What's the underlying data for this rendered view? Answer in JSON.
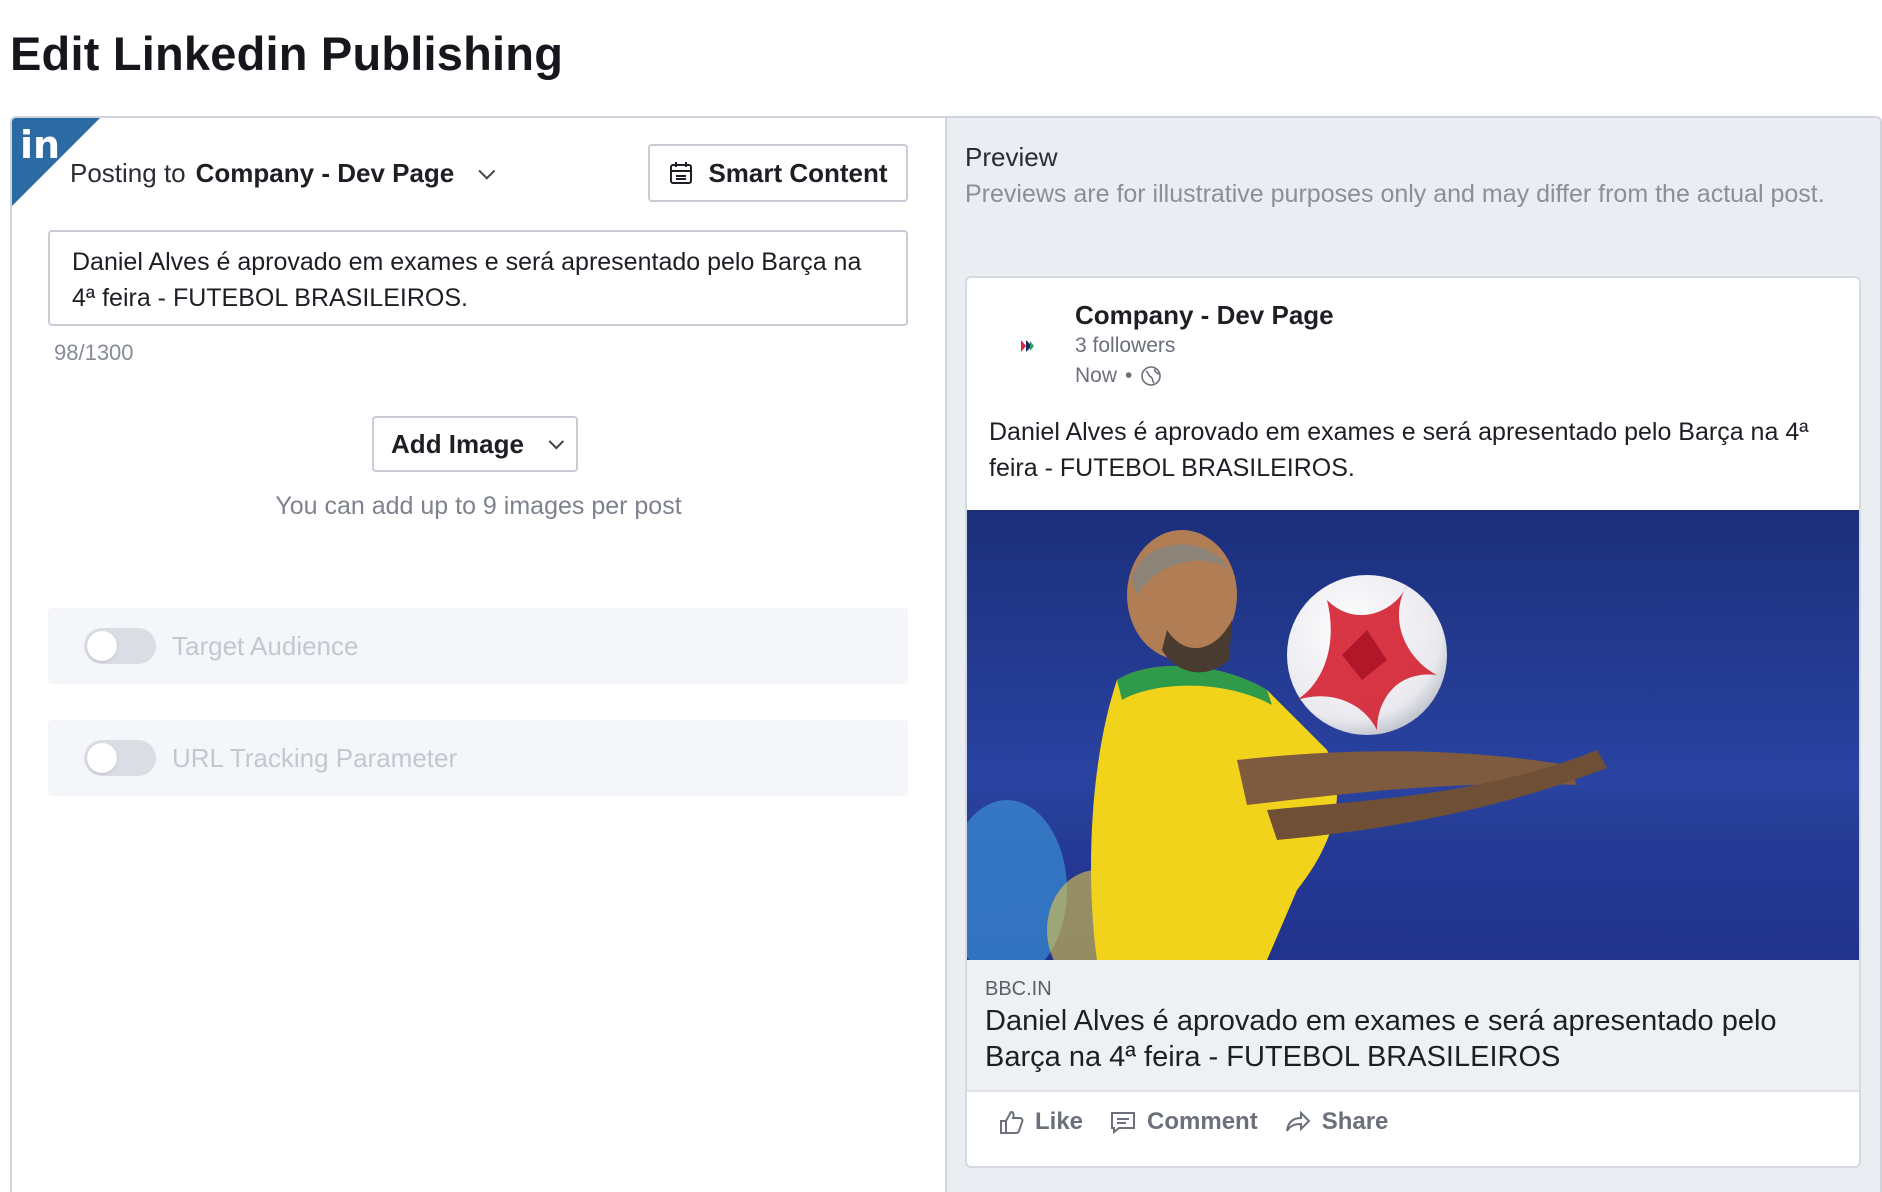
{
  "page": {
    "title": "Edit Linkedin Publishing"
  },
  "editor": {
    "network_badge": "in",
    "posting_prefix": "Posting to",
    "posting_target": "Company - Dev Page",
    "smart_content_label": "Smart Content",
    "post_text": "Daniel Alves é aprovado em exames e será apresentado pelo Barça na 4ª feira - FUTEBOL BRASILEIROS.",
    "char_count": "98/1300",
    "add_image_label": "Add Image",
    "add_image_hint": "You can add up to 9 images per post",
    "options": [
      {
        "label": "Target Audience",
        "enabled": false
      },
      {
        "label": "URL Tracking Parameter",
        "enabled": false
      }
    ]
  },
  "preview": {
    "title": "Preview",
    "note": "Previews are for illustrative purposes only and may differ from the actual post.",
    "card": {
      "company": "Company - Dev Page",
      "followers": "3 followers",
      "time": "Now",
      "text": "Daniel Alves é aprovado em exames e será apresentado pelo Barça na 4ª feira - FUTEBOL BRASILEIROS.",
      "link_domain": "BBC.IN",
      "link_title": "Daniel Alves é aprovado em exames e será apresentado pelo Barça na 4ª feira - FUTEBOL BRASILEIROS",
      "actions": [
        "Like",
        "Comment",
        "Share"
      ]
    }
  },
  "colors": {
    "linkedin_blue": "#2b6aa3",
    "preview_bg": "#eaedf2",
    "jersey_yellow": "#f2d31b",
    "field_blue": "#1f3a8f"
  }
}
